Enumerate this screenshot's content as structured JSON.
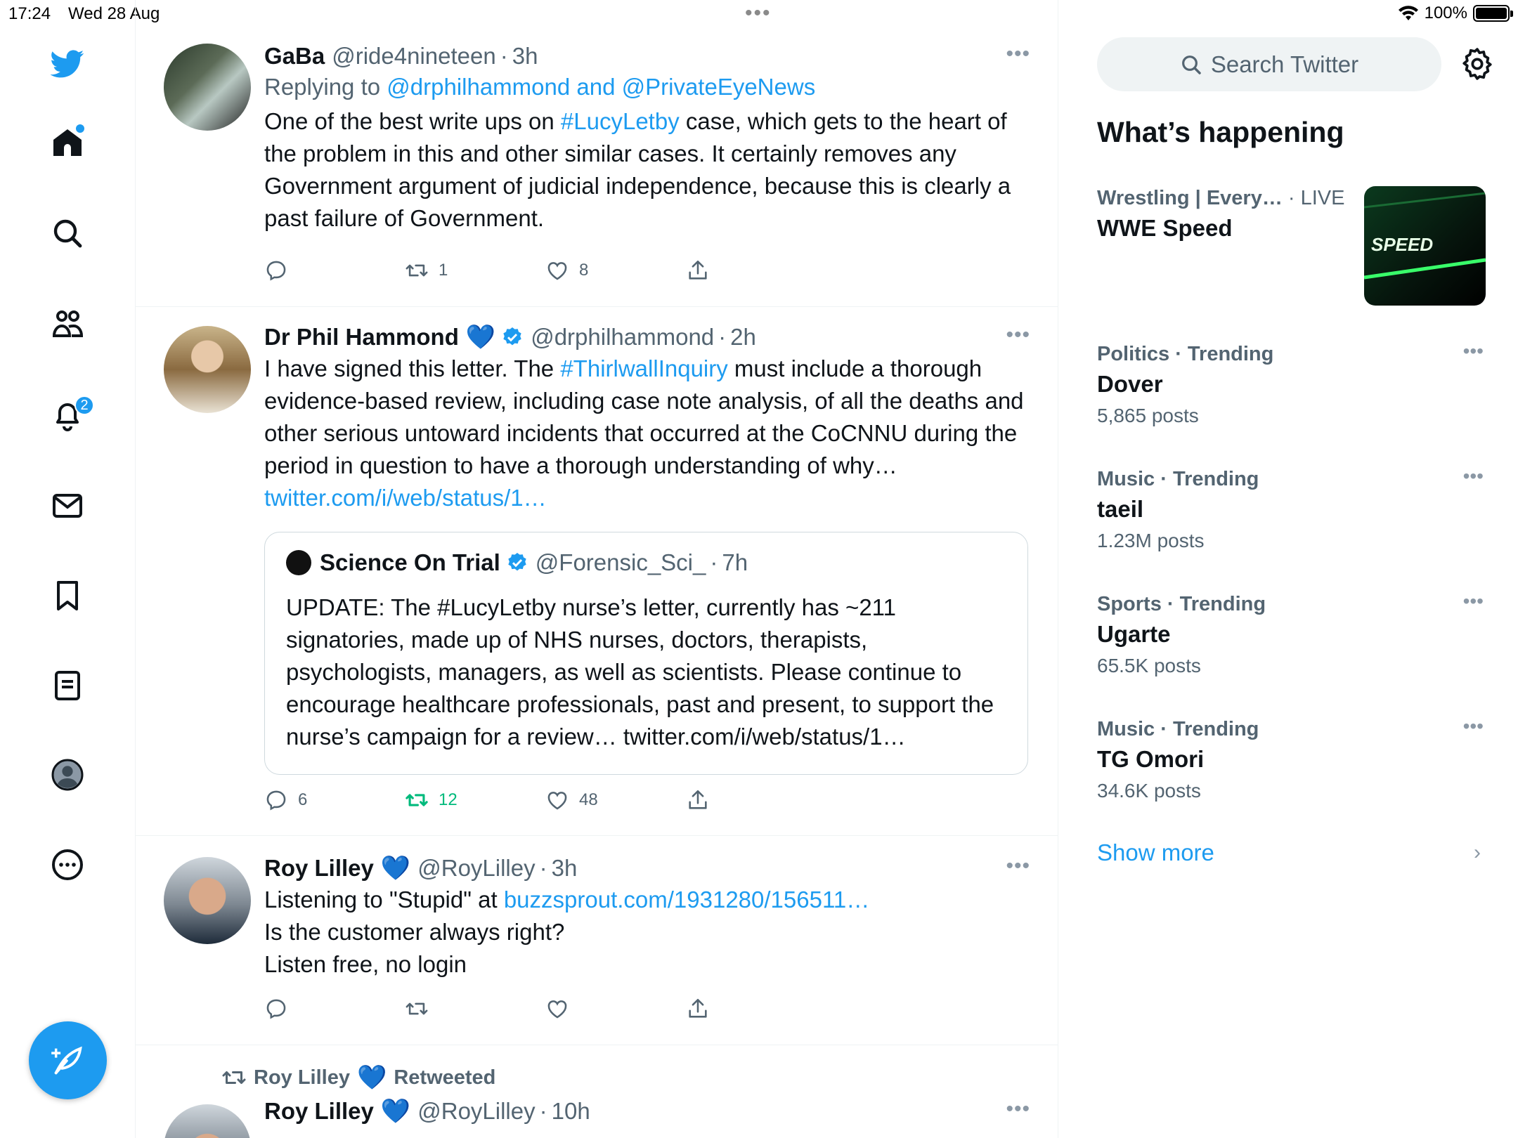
{
  "status_bar": {
    "time": "17:24",
    "date": "Wed 28 Aug",
    "battery": "100%",
    "battery_level": 1.0
  },
  "nav": {
    "notifications_badge": "2"
  },
  "tweets": [
    {
      "name": "GaBa",
      "handle": "@ride4nineteen",
      "time": "3h",
      "replying_prefix": "Replying to ",
      "replying_to": "@drphilhammond and @PrivateEyeNews",
      "text_before": "One of the best write ups on ",
      "hashtag": "#LucyLetby",
      "text_after": " case, which gets to the heart of the problem in this and other similar cases. It certainly removes any Government argument of judicial independence, because this is clearly a past failure of Government.",
      "replies": "",
      "retweets": "1",
      "likes": "8"
    },
    {
      "name": "Dr Phil Hammond",
      "handle": "@drphilhammond",
      "time": "2h",
      "text_before": "I have signed this letter. The ",
      "hashtag": "#ThirlwallInquiry",
      "text_after": " must include a thorough evidence-based review, including case note analysis, of all the deaths and other serious untoward incidents that occurred at the CoCNNU during the period in question to have a thorough understanding of why…",
      "link": "twitter.com/i/web/status/1…",
      "quote": {
        "name": "Science On Trial",
        "handle": "@Forensic_Sci_",
        "time": "7h",
        "text": "UPDATE: The #LucyLetby nurse’s letter, currently has ~211 signatories, made up of NHS nurses, doctors, therapists, psychologists, managers, as well as scientists. Please continue to encourage healthcare professionals, past and present, to support the nurse’s campaign for a review… twitter.com/i/web/status/1…"
      },
      "replies": "6",
      "retweets": "12",
      "likes": "48"
    },
    {
      "name": "Roy Lilley",
      "handle": "@RoyLilley",
      "time": "3h",
      "text_before": "Listening to \"Stupid\" at ",
      "link": "buzzsprout.com/1931280/156511…",
      "line2": "Is the customer always right?",
      "line3": "Listen free, no login",
      "replies": "",
      "retweets": "",
      "likes": ""
    },
    {
      "retweeted_by": "Roy Lilley",
      "retweeted_label": "Retweeted",
      "name": "Roy Lilley",
      "handle": "@RoyLilley",
      "time": "10h"
    }
  ],
  "sidebar": {
    "search_placeholder": "Search Twitter",
    "whats_happening": "What’s happening",
    "live": {
      "context": "Wrestling | Every…",
      "live_label": "· LIVE",
      "title": "WWE Speed",
      "thumb_text": "SPEED"
    },
    "trends": [
      {
        "context": "Politics · Trending",
        "title": "Dover",
        "count": "5,865 posts"
      },
      {
        "context": "Music · Trending",
        "title": "taeil",
        "count": "1.23M posts"
      },
      {
        "context": "Sports · Trending",
        "title": "Ugarte",
        "count": "65.5K posts"
      },
      {
        "context": "Music · Trending",
        "title": "TG Omori",
        "count": "34.6K posts"
      }
    ],
    "show_more": "Show more"
  }
}
